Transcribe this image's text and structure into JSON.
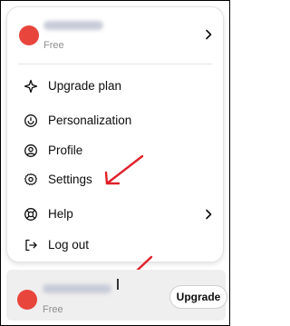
{
  "menu": {
    "account": {
      "plan": "Free",
      "icon": "chevron-right-icon"
    },
    "items": [
      {
        "label": "Upgrade plan",
        "icon": "sparkle-icon"
      },
      {
        "label": "Personalization",
        "icon": "personalization-icon"
      },
      {
        "label": "Profile",
        "icon": "profile-icon"
      },
      {
        "label": "Settings",
        "icon": "gear-icon"
      },
      {
        "label": "Help",
        "icon": "help-icon",
        "submenu": true
      },
      {
        "label": "Log out",
        "icon": "logout-icon"
      }
    ]
  },
  "bottom_bar": {
    "plan": "Free",
    "upgrade_label": "Upgrade"
  },
  "colors": {
    "avatar": "#e8453c",
    "annotation_arrow": "#e0202a",
    "bottom_bar_bg": "#efefef"
  }
}
